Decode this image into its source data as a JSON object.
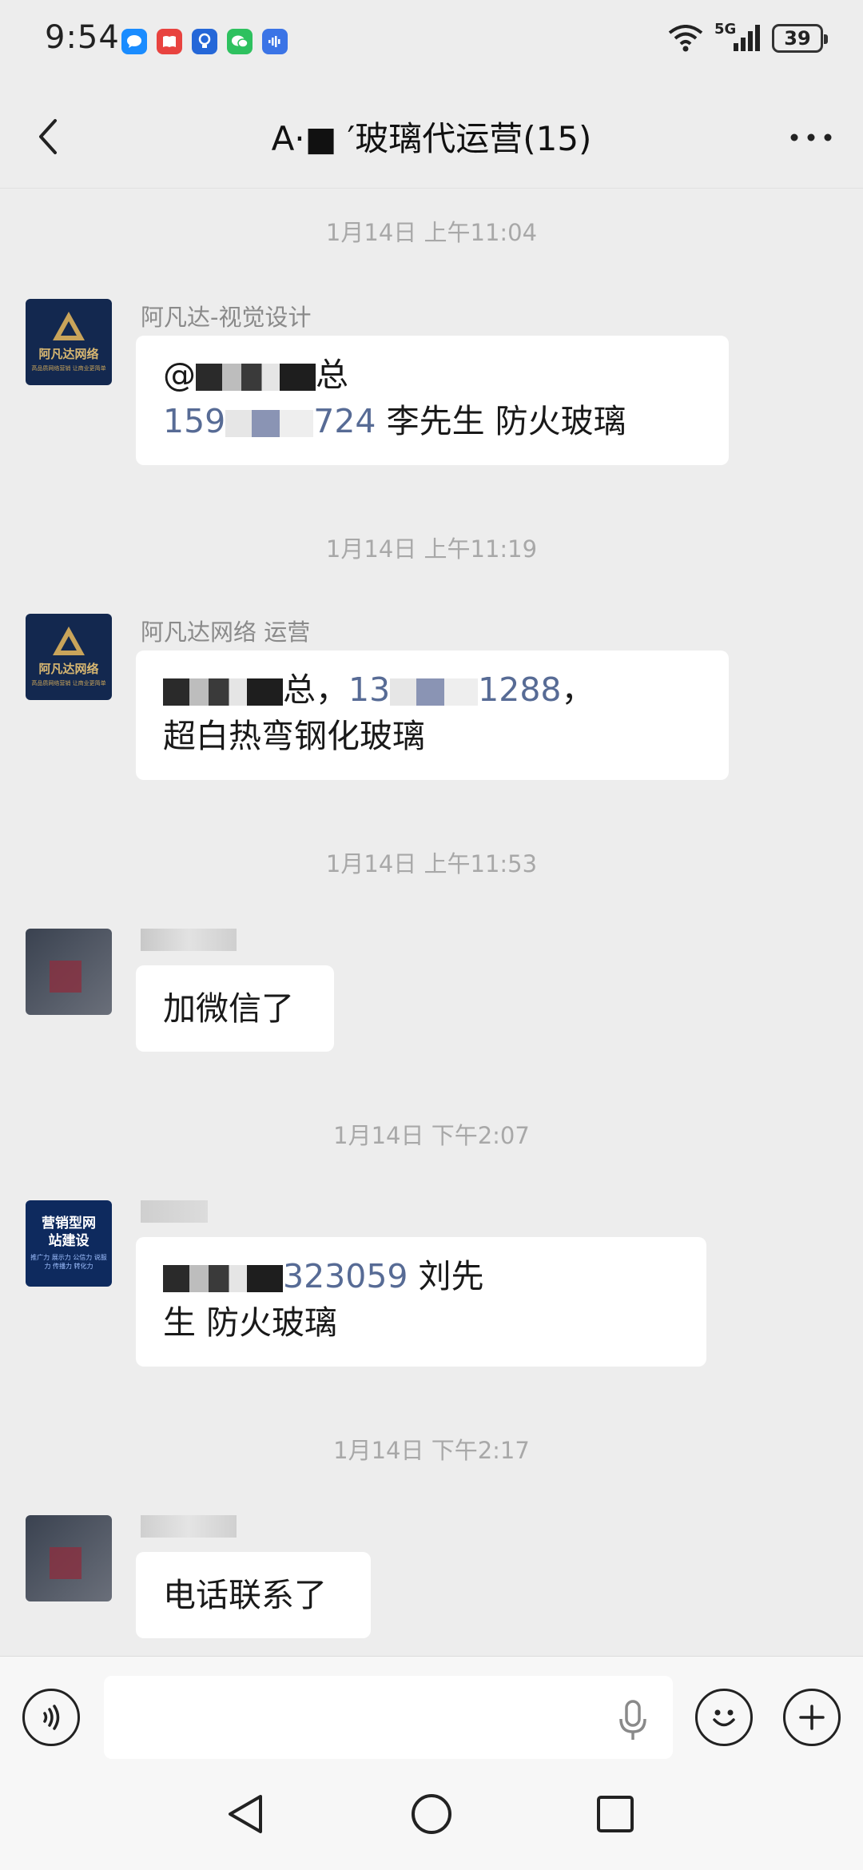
{
  "status_bar": {
    "time": "9:54",
    "network": "5G",
    "battery": "39",
    "app_icons": [
      "messages-app-icon",
      "book-app-icon",
      "bulb-app-icon",
      "wechat-app-icon",
      "voice-app-icon"
    ]
  },
  "header": {
    "title": "A·■ ′玻璃代运营(15)",
    "back_icon": "chevron-left-icon",
    "more_icon": "more-dots-icon"
  },
  "messages": [
    {
      "timestamp": "1月14日 上午11:04",
      "sender": "阿凡达-视觉设计",
      "avatar": "阿凡达网络",
      "avatar_sub": "高品质网络营销 让商业更简单",
      "lines": [
        [
          {
            "t": "@"
          },
          {
            "blur": true
          },
          {
            "t": "总"
          }
        ],
        [
          {
            "t": "159",
            "num": true
          },
          {
            "blur": true
          },
          {
            "t": "724",
            "num": true
          },
          {
            "t": "  李先生 防火玻璃"
          }
        ]
      ]
    },
    {
      "timestamp": "1月14日 上午11:19",
      "sender": "阿凡达网络 运营",
      "avatar": "阿凡达网络",
      "avatar_sub": "高品质网络营销 让商业更简单",
      "lines": [
        [
          {
            "blur": true
          },
          {
            "t": "总，"
          },
          {
            "t": "13",
            "num": true
          },
          {
            "blur": true
          },
          {
            "t": "1288",
            "num": true
          },
          {
            "t": "，"
          }
        ],
        [
          {
            "t": "超白热弯钢化玻璃"
          }
        ]
      ]
    },
    {
      "timestamp": "1月14日 上午11:53",
      "sender": "",
      "avatar": "",
      "lines": [
        [
          {
            "t": "加微信了"
          }
        ]
      ]
    },
    {
      "timestamp": "1月14日 下午2:07",
      "sender": "",
      "avatar": "营销型网站建设",
      "avatar_sub": "推广力 展示力 公信力 说服力 传播力 转化力",
      "lines": [
        [
          {
            "blur": true
          },
          {
            "t": "323059",
            "num": true
          },
          {
            "t": "  刘先"
          }
        ],
        [
          {
            "t": "生 防火玻璃"
          }
        ]
      ]
    },
    {
      "timestamp": "1月14日 下午2:17",
      "sender": "",
      "avatar": "",
      "lines": [
        [
          {
            "t": "电话联系了"
          }
        ]
      ]
    }
  ],
  "input_bar": {
    "voice_icon": "voice-mode-icon",
    "text_placeholder": "",
    "mic_icon": "microphone-icon",
    "emoji_icon": "emoji-icon",
    "plus_icon": "plus-icon"
  },
  "nav_bar": {
    "back_icon": "nav-back-icon",
    "home_icon": "nav-home-icon",
    "recents_icon": "nav-recents-icon"
  },
  "colors": {
    "background": "#ededed",
    "bubble": "#ffffff",
    "link_number": "#576b95",
    "timestamp": "#a8a8a8",
    "sender": "#8a8a8a",
    "avatar_navy": "#13284f",
    "avatar_gold": "#c9a45a"
  }
}
